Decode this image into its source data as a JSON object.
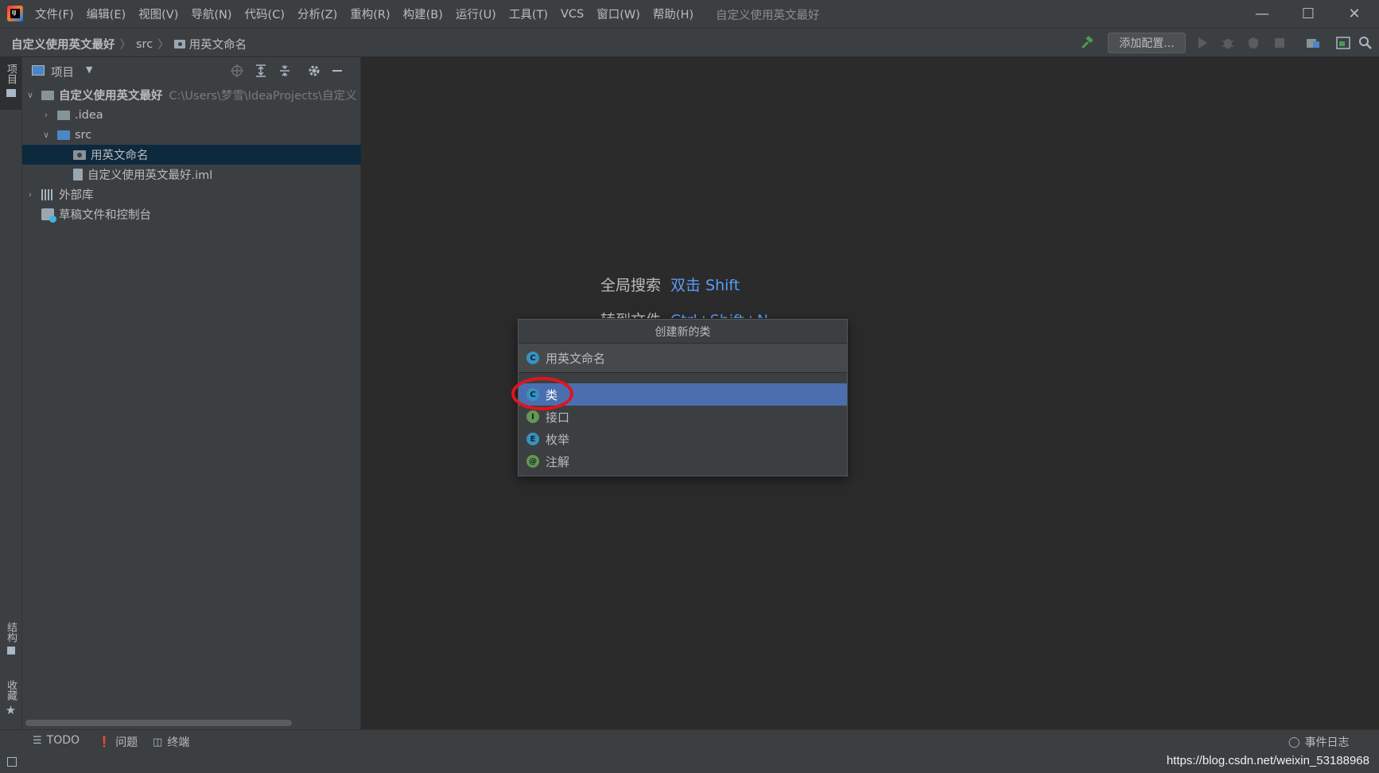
{
  "menu": {
    "items": [
      "文件(F)",
      "编辑(E)",
      "视图(V)",
      "导航(N)",
      "代码(C)",
      "分析(Z)",
      "重构(R)",
      "构建(B)",
      "运行(U)",
      "工具(T)",
      "VCS",
      "窗口(W)",
      "帮助(H)"
    ]
  },
  "window": {
    "title": "自定义使用英文最好"
  },
  "breadcrumb": {
    "project": "自定义使用英文最好",
    "src": "src",
    "package": "用英文命名"
  },
  "toolbar": {
    "add_config": "添加配置..."
  },
  "left_tabs": {
    "project": "项目",
    "structure": "结构",
    "favorites": "收藏"
  },
  "panel": {
    "title": "项目"
  },
  "tree": {
    "root_name": "自定义使用英文最好",
    "root_path": "C:\\Users\\梦雪\\IdeaProjects\\自定义",
    "idea": ".idea",
    "src": "src",
    "package": "用英文命名",
    "iml": "自定义使用英文最好.iml",
    "libs": "外部库",
    "scratches": "草稿文件和控制台"
  },
  "editor_hints": {
    "search_label": "全局搜索",
    "search_key": "双击 Shift",
    "goto_label": "转到文件",
    "goto_key": "Ctrl+Shift+N"
  },
  "dialog": {
    "title": "创建新的类",
    "input_value": "用英文命名",
    "input_badge": "C",
    "options": [
      {
        "badge": "C",
        "label": "类",
        "selected": true
      },
      {
        "badge": "I",
        "label": "接口",
        "selected": false
      },
      {
        "badge": "E",
        "label": "枚举",
        "selected": false
      },
      {
        "badge": "@",
        "label": "注解",
        "selected": false
      }
    ]
  },
  "bottom_tools": {
    "todo": "TODO",
    "problems": "问题",
    "terminal": "终端",
    "event_log": "事件日志"
  },
  "watermark": "https://blog.csdn.net/weixin_53188968",
  "colors": {
    "accent_selection": "#4b6eaf",
    "tree_selection": "#0d293e",
    "highlight_ring": "#e0141d",
    "key_hint": "#589df6"
  },
  "icons": [
    "search-icon",
    "gear-icon",
    "run-icon",
    "debug-icon",
    "stop-icon",
    "hammer-icon",
    "star-icon"
  ]
}
